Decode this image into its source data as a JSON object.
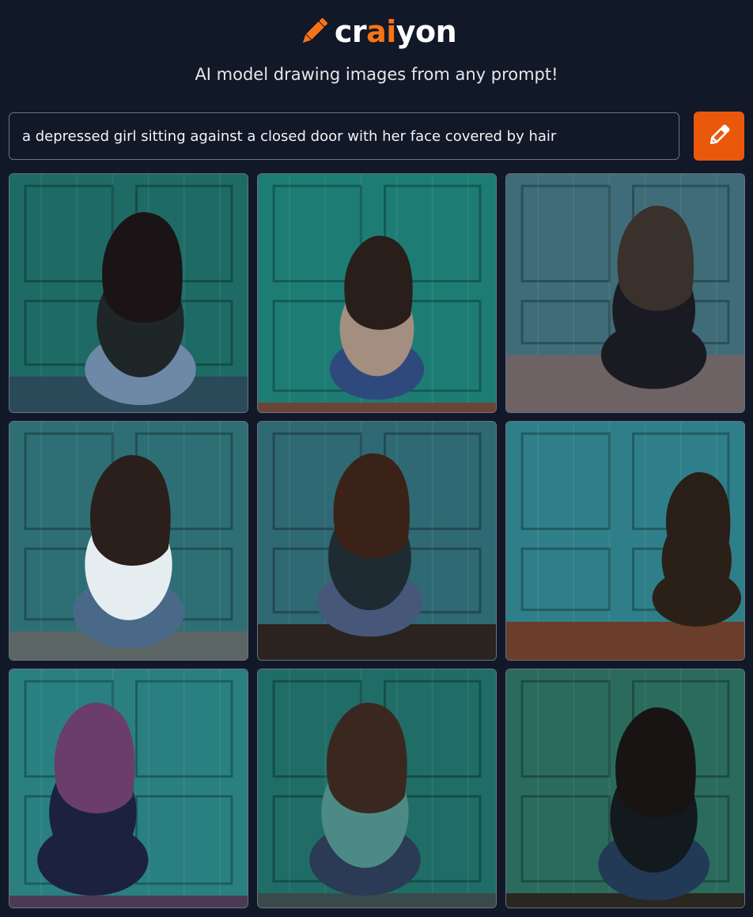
{
  "app": {
    "logo_part1": "cr",
    "logo_accent": "ai",
    "logo_part2": "yon",
    "tagline": "AI model drawing images from any prompt!",
    "brand_color": "#f97316",
    "logo_icon": "pencil-icon"
  },
  "prompt": {
    "value": "a depressed girl sitting against a closed door with her face covered by hair",
    "placeholder": ""
  },
  "draw_button": {
    "icon": "pencil-icon",
    "color": "#ea580c"
  },
  "results": [
    {
      "id": 1,
      "door": "#1e6b65",
      "floor": "#2a4a5a",
      "hair": "#1a1416",
      "clothes": "#1f2627",
      "pants": "#6e88a8"
    },
    {
      "id": 2,
      "door": "#1d7d74",
      "floor": "#6b4436",
      "hair": "#2a1e1a",
      "clothes": "#a48e80",
      "pants": "#2e4a7c"
    },
    {
      "id": 3,
      "door": "#3f6c78",
      "floor": "#6d6264",
      "hair": "#3a302c",
      "clothes": "#1a1b22",
      "pants": "#1a1b22"
    },
    {
      "id": 4,
      "door": "#2d6f74",
      "floor": "#5b6564",
      "hair": "#2b1f1c",
      "clothes": "#e6edf0",
      "pants": "#4a6888"
    },
    {
      "id": 5,
      "door": "#2f6973",
      "floor": "#2a2320",
      "hair": "#3b2218",
      "clothes": "#1f2b33",
      "pants": "#47577a"
    },
    {
      "id": 6,
      "door": "#2f7f8a",
      "floor": "#6a3e2a",
      "hair": "#2a1e18",
      "clothes": "#2a2018",
      "pants": "#2a2018"
    },
    {
      "id": 7,
      "door": "#2a8080",
      "floor": "#4a3a55",
      "hair": "#6a3d6a",
      "clothes": "#1c2140",
      "pants": "#1c2140"
    },
    {
      "id": 8,
      "door": "#1f6d66",
      "floor": "#3a4a4a",
      "hair": "#3a2820",
      "clothes": "#4e8a85",
      "pants": "#2b3a55"
    },
    {
      "id": 9,
      "door": "#2a6b5c",
      "floor": "#2a2620",
      "hair": "#181414",
      "clothes": "#121a1e",
      "pants": "#223a55"
    }
  ]
}
